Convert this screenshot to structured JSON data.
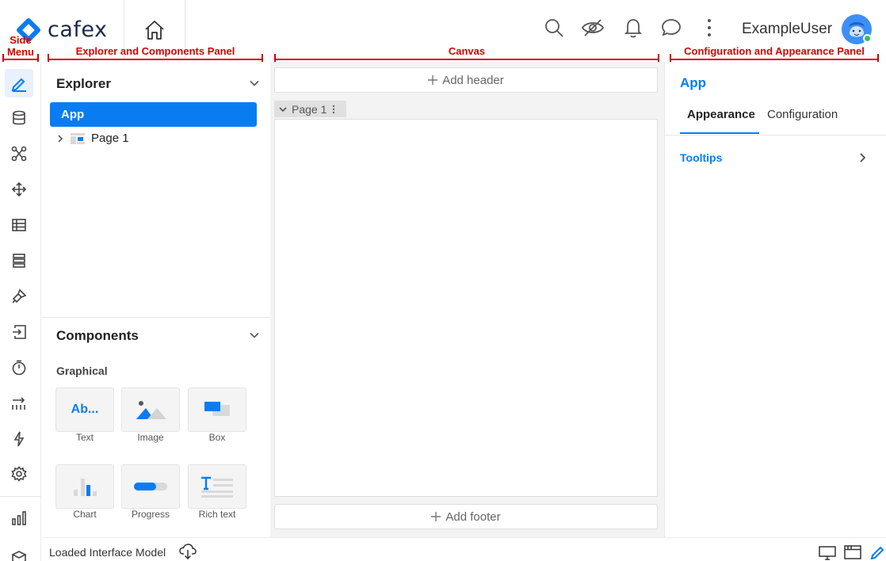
{
  "brand": {
    "name": "cafex",
    "color": "#0a7cf2"
  },
  "header": {
    "home_icon": "home-icon",
    "icons": [
      "search-icon",
      "eye-off-icon",
      "bell-icon",
      "chat-icon",
      "more-vertical-icon"
    ],
    "username": "ExampleUser"
  },
  "annotations": {
    "side_menu": "Side Menu",
    "explorer_panel": "Explorer and Components Panel",
    "canvas": "Canvas",
    "config_panel": "Configuration and Appearance Panel"
  },
  "sidemenu": {
    "items": [
      {
        "icon": "pencil-icon",
        "active": true
      },
      {
        "icon": "database-icon"
      },
      {
        "icon": "workflow-icon"
      },
      {
        "icon": "move-icon"
      },
      {
        "icon": "table-icon"
      },
      {
        "icon": "list-icon"
      },
      {
        "icon": "brush-icon"
      },
      {
        "icon": "import-icon"
      },
      {
        "icon": "timer-icon"
      },
      {
        "icon": "transitions-icon"
      },
      {
        "icon": "lightning-icon"
      },
      {
        "icon": "gear-icon"
      },
      {
        "icon": "bar-chart-icon"
      },
      {
        "icon": "box-icon"
      }
    ]
  },
  "explorer": {
    "title": "Explorer",
    "app_label": "App",
    "page_label": "Page 1"
  },
  "components": {
    "title": "Components",
    "group": "Graphical",
    "items": [
      {
        "label": "Text",
        "preview": "Ab..."
      },
      {
        "label": "Image"
      },
      {
        "label": "Box"
      },
      {
        "label": "Chart"
      },
      {
        "label": "Progress"
      },
      {
        "label": "Rich text"
      }
    ]
  },
  "canvas": {
    "add_header": "Add header",
    "page_tab": "Page 1",
    "add_footer": "Add footer"
  },
  "config": {
    "title": "App",
    "tabs": [
      {
        "label": "Appearance",
        "active": true
      },
      {
        "label": "Configuration"
      }
    ],
    "sections": [
      {
        "label": "Tooltips"
      }
    ]
  },
  "footer": {
    "status": "Loaded Interface Model",
    "view_icons": [
      "desktop-icon",
      "browser-window-icon",
      "edit-icon"
    ]
  }
}
